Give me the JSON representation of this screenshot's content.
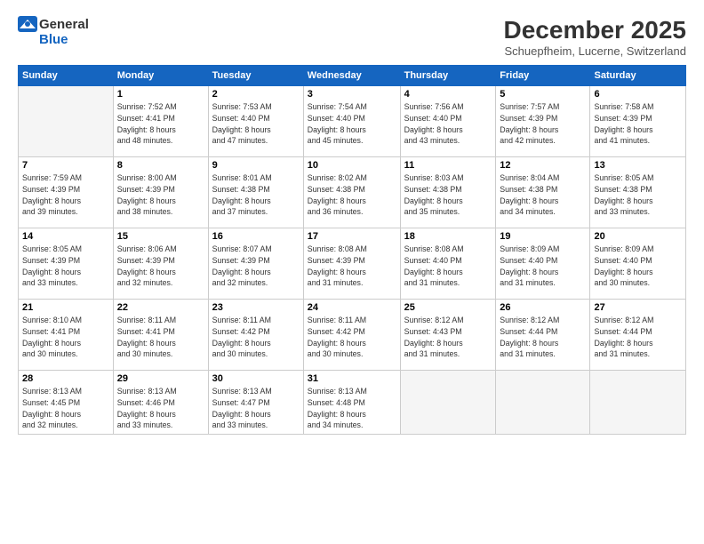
{
  "header": {
    "logo_general": "General",
    "logo_blue": "Blue",
    "month_title": "December 2025",
    "subtitle": "Schuepfheim, Lucerne, Switzerland"
  },
  "days_of_week": [
    "Sunday",
    "Monday",
    "Tuesday",
    "Wednesday",
    "Thursday",
    "Friday",
    "Saturday"
  ],
  "weeks": [
    [
      {
        "date": "",
        "empty": true
      },
      {
        "date": "1",
        "sunrise": "Sunrise: 7:52 AM",
        "sunset": "Sunset: 4:41 PM",
        "daylight": "Daylight: 8 hours and 48 minutes."
      },
      {
        "date": "2",
        "sunrise": "Sunrise: 7:53 AM",
        "sunset": "Sunset: 4:40 PM",
        "daylight": "Daylight: 8 hours and 47 minutes."
      },
      {
        "date": "3",
        "sunrise": "Sunrise: 7:54 AM",
        "sunset": "Sunset: 4:40 PM",
        "daylight": "Daylight: 8 hours and 45 minutes."
      },
      {
        "date": "4",
        "sunrise": "Sunrise: 7:56 AM",
        "sunset": "Sunset: 4:40 PM",
        "daylight": "Daylight: 8 hours and 43 minutes."
      },
      {
        "date": "5",
        "sunrise": "Sunrise: 7:57 AM",
        "sunset": "Sunset: 4:39 PM",
        "daylight": "Daylight: 8 hours and 42 minutes."
      },
      {
        "date": "6",
        "sunrise": "Sunrise: 7:58 AM",
        "sunset": "Sunset: 4:39 PM",
        "daylight": "Daylight: 8 hours and 41 minutes."
      }
    ],
    [
      {
        "date": "7",
        "sunrise": "Sunrise: 7:59 AM",
        "sunset": "Sunset: 4:39 PM",
        "daylight": "Daylight: 8 hours and 39 minutes."
      },
      {
        "date": "8",
        "sunrise": "Sunrise: 8:00 AM",
        "sunset": "Sunset: 4:39 PM",
        "daylight": "Daylight: 8 hours and 38 minutes."
      },
      {
        "date": "9",
        "sunrise": "Sunrise: 8:01 AM",
        "sunset": "Sunset: 4:38 PM",
        "daylight": "Daylight: 8 hours and 37 minutes."
      },
      {
        "date": "10",
        "sunrise": "Sunrise: 8:02 AM",
        "sunset": "Sunset: 4:38 PM",
        "daylight": "Daylight: 8 hours and 36 minutes."
      },
      {
        "date": "11",
        "sunrise": "Sunrise: 8:03 AM",
        "sunset": "Sunset: 4:38 PM",
        "daylight": "Daylight: 8 hours and 35 minutes."
      },
      {
        "date": "12",
        "sunrise": "Sunrise: 8:04 AM",
        "sunset": "Sunset: 4:38 PM",
        "daylight": "Daylight: 8 hours and 34 minutes."
      },
      {
        "date": "13",
        "sunrise": "Sunrise: 8:05 AM",
        "sunset": "Sunset: 4:38 PM",
        "daylight": "Daylight: 8 hours and 33 minutes."
      }
    ],
    [
      {
        "date": "14",
        "sunrise": "Sunrise: 8:05 AM",
        "sunset": "Sunset: 4:39 PM",
        "daylight": "Daylight: 8 hours and 33 minutes."
      },
      {
        "date": "15",
        "sunrise": "Sunrise: 8:06 AM",
        "sunset": "Sunset: 4:39 PM",
        "daylight": "Daylight: 8 hours and 32 minutes."
      },
      {
        "date": "16",
        "sunrise": "Sunrise: 8:07 AM",
        "sunset": "Sunset: 4:39 PM",
        "daylight": "Daylight: 8 hours and 32 minutes."
      },
      {
        "date": "17",
        "sunrise": "Sunrise: 8:08 AM",
        "sunset": "Sunset: 4:39 PM",
        "daylight": "Daylight: 8 hours and 31 minutes."
      },
      {
        "date": "18",
        "sunrise": "Sunrise: 8:08 AM",
        "sunset": "Sunset: 4:40 PM",
        "daylight": "Daylight: 8 hours and 31 minutes."
      },
      {
        "date": "19",
        "sunrise": "Sunrise: 8:09 AM",
        "sunset": "Sunset: 4:40 PM",
        "daylight": "Daylight: 8 hours and 31 minutes."
      },
      {
        "date": "20",
        "sunrise": "Sunrise: 8:09 AM",
        "sunset": "Sunset: 4:40 PM",
        "daylight": "Daylight: 8 hours and 30 minutes."
      }
    ],
    [
      {
        "date": "21",
        "sunrise": "Sunrise: 8:10 AM",
        "sunset": "Sunset: 4:41 PM",
        "daylight": "Daylight: 8 hours and 30 minutes."
      },
      {
        "date": "22",
        "sunrise": "Sunrise: 8:11 AM",
        "sunset": "Sunset: 4:41 PM",
        "daylight": "Daylight: 8 hours and 30 minutes."
      },
      {
        "date": "23",
        "sunrise": "Sunrise: 8:11 AM",
        "sunset": "Sunset: 4:42 PM",
        "daylight": "Daylight: 8 hours and 30 minutes."
      },
      {
        "date": "24",
        "sunrise": "Sunrise: 8:11 AM",
        "sunset": "Sunset: 4:42 PM",
        "daylight": "Daylight: 8 hours and 30 minutes."
      },
      {
        "date": "25",
        "sunrise": "Sunrise: 8:12 AM",
        "sunset": "Sunset: 4:43 PM",
        "daylight": "Daylight: 8 hours and 31 minutes."
      },
      {
        "date": "26",
        "sunrise": "Sunrise: 8:12 AM",
        "sunset": "Sunset: 4:44 PM",
        "daylight": "Daylight: 8 hours and 31 minutes."
      },
      {
        "date": "27",
        "sunrise": "Sunrise: 8:12 AM",
        "sunset": "Sunset: 4:44 PM",
        "daylight": "Daylight: 8 hours and 31 minutes."
      }
    ],
    [
      {
        "date": "28",
        "sunrise": "Sunrise: 8:13 AM",
        "sunset": "Sunset: 4:45 PM",
        "daylight": "Daylight: 8 hours and 32 minutes."
      },
      {
        "date": "29",
        "sunrise": "Sunrise: 8:13 AM",
        "sunset": "Sunset: 4:46 PM",
        "daylight": "Daylight: 8 hours and 33 minutes."
      },
      {
        "date": "30",
        "sunrise": "Sunrise: 8:13 AM",
        "sunset": "Sunset: 4:47 PM",
        "daylight": "Daylight: 8 hours and 33 minutes."
      },
      {
        "date": "31",
        "sunrise": "Sunrise: 8:13 AM",
        "sunset": "Sunset: 4:48 PM",
        "daylight": "Daylight: 8 hours and 34 minutes."
      },
      {
        "date": "",
        "empty": true
      },
      {
        "date": "",
        "empty": true
      },
      {
        "date": "",
        "empty": true
      }
    ]
  ]
}
